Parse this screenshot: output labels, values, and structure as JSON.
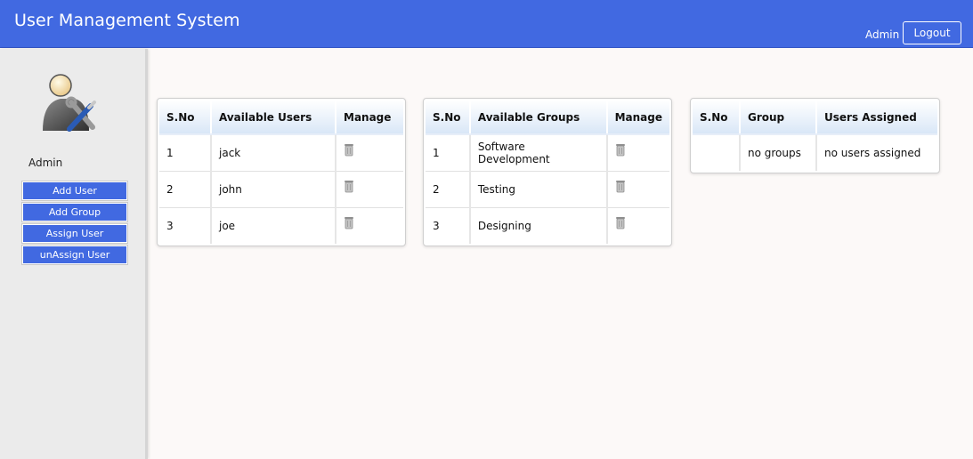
{
  "header": {
    "title": "User Management System",
    "user": "Admin",
    "logout_label": "Logout"
  },
  "sidebar": {
    "user": "Admin",
    "buttons": [
      "Add User",
      "Add Group",
      "Assign User",
      "unAssign User"
    ]
  },
  "users_table": {
    "headers": [
      "S.No",
      "Available Users",
      "Manage"
    ],
    "rows": [
      {
        "sno": "1",
        "name": "jack"
      },
      {
        "sno": "2",
        "name": "john"
      },
      {
        "sno": "3",
        "name": "joe"
      }
    ]
  },
  "groups_table": {
    "headers": [
      "S.No",
      "Available Groups",
      "Manage"
    ],
    "rows": [
      {
        "sno": "1",
        "name": "Software Development"
      },
      {
        "sno": "2",
        "name": "Testing"
      },
      {
        "sno": "3",
        "name": "Designing"
      }
    ]
  },
  "assign_table": {
    "headers": [
      "S.No",
      "Group",
      "Users Assigned"
    ],
    "rows": [
      {
        "sno": "",
        "group": "no groups",
        "users": "no users assigned"
      }
    ]
  },
  "icons": {
    "avatar": "admin-tools-avatar-icon",
    "manage": "trash-icon"
  },
  "colors": {
    "header": "#4169e1",
    "button": "#4169e1",
    "table_header": "#d9e7f7"
  }
}
